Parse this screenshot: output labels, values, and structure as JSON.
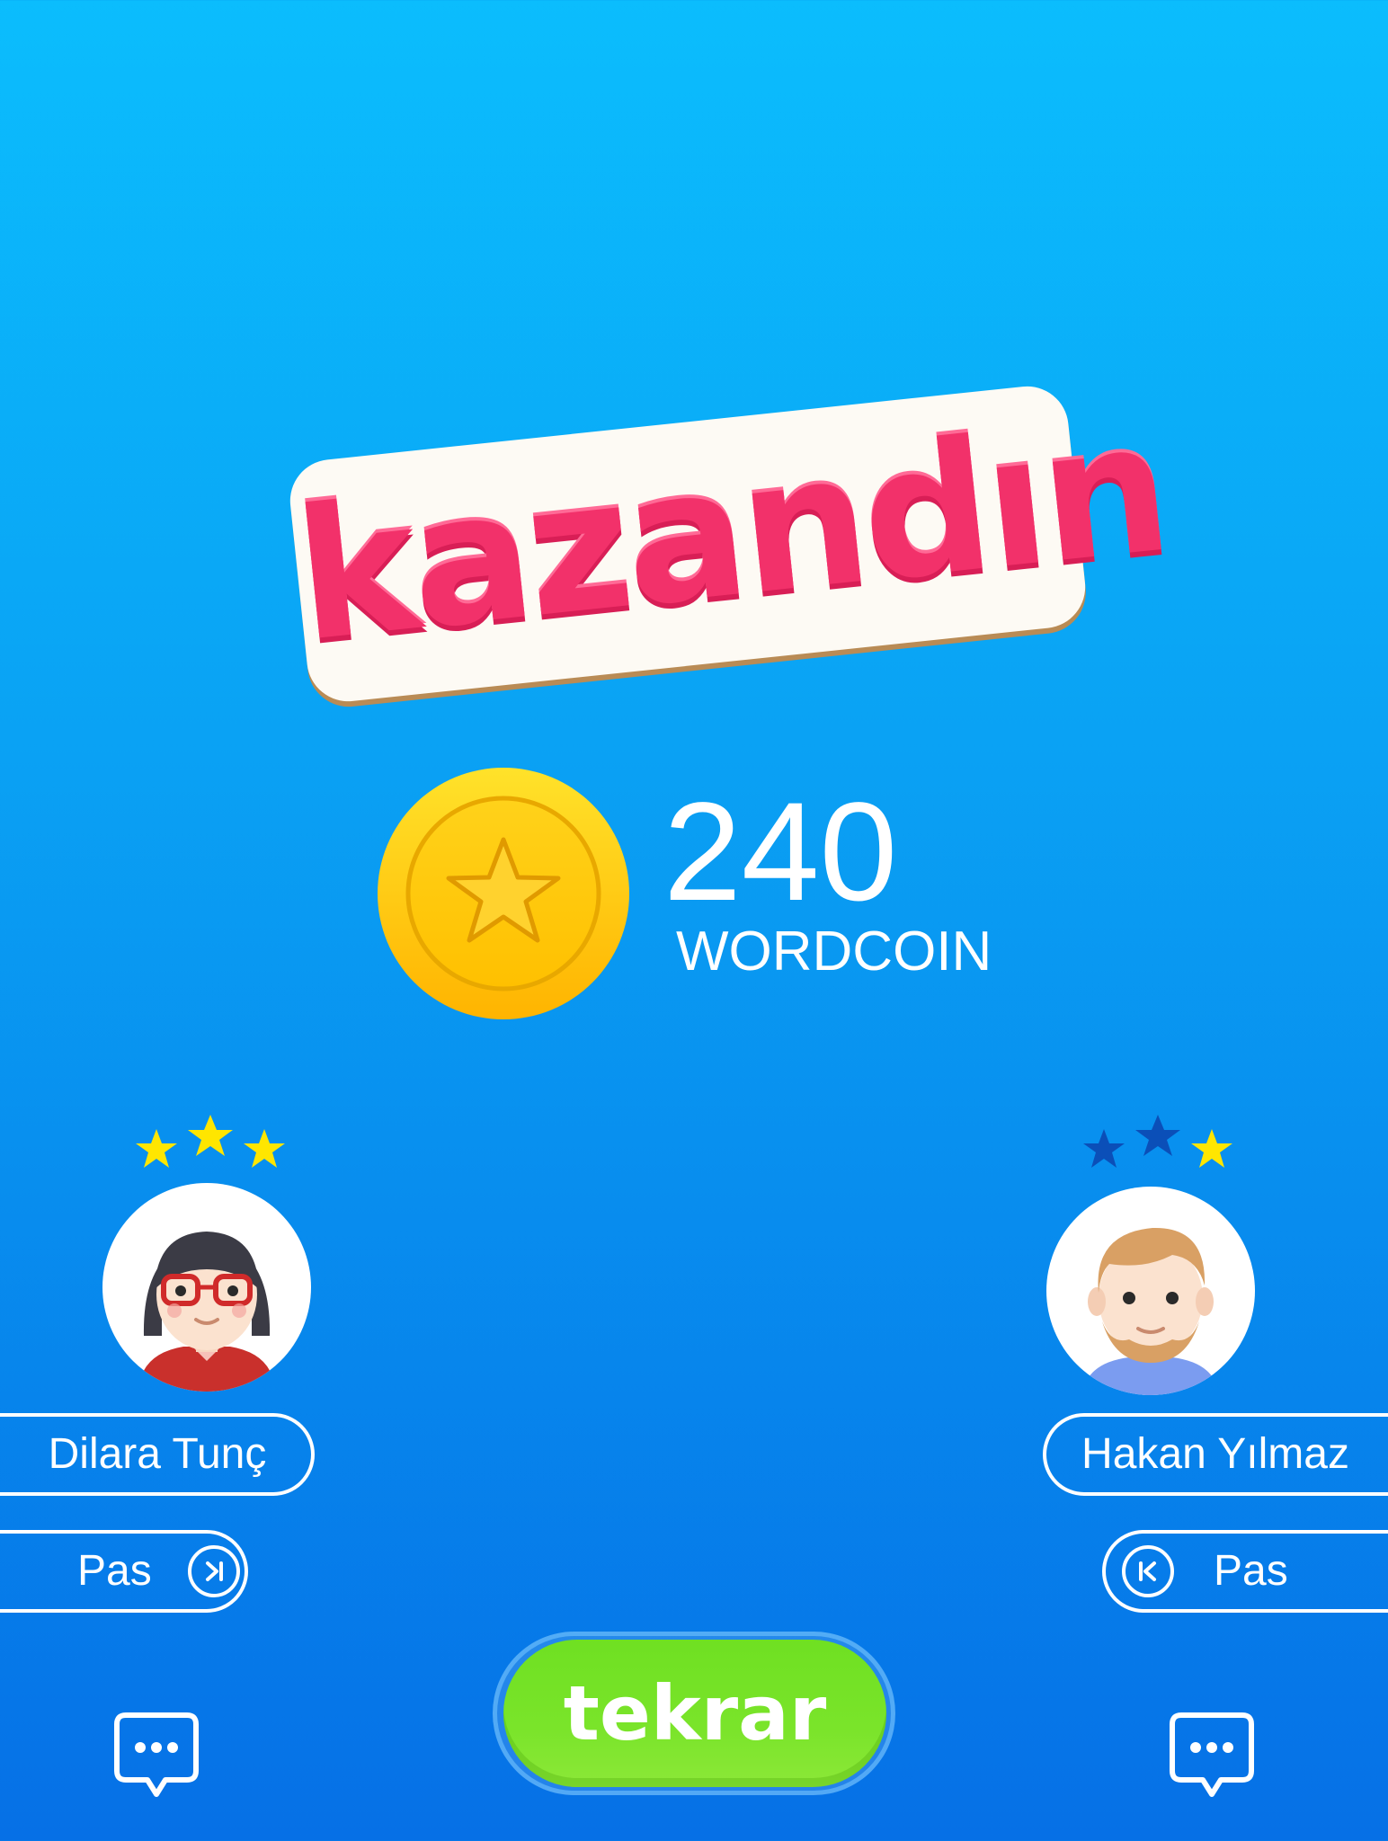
{
  "result": {
    "title": "kazandın",
    "amount": "240",
    "unit": "WORDCOIN"
  },
  "players": [
    {
      "name": "Dilara Tunç",
      "pass_label": "Pas",
      "stars_lit": 3,
      "stars_total": 3
    },
    {
      "name": "Hakan Yılmaz",
      "pass_label": "Pas",
      "stars_lit": 1,
      "stars_total": 3
    }
  ],
  "retry_label": "tekrar",
  "colors": {
    "title_pink": "#f2316a",
    "coin_gold": "#ffc400",
    "star_lit": "#ffe600",
    "star_dim": "#0b4fb8",
    "retry_green": "#76e126"
  },
  "icons": {
    "coin": "coin-star-icon",
    "skip_forward": "skip-forward-icon",
    "skip_back": "skip-back-icon",
    "chat": "chat-bubble-icon"
  }
}
